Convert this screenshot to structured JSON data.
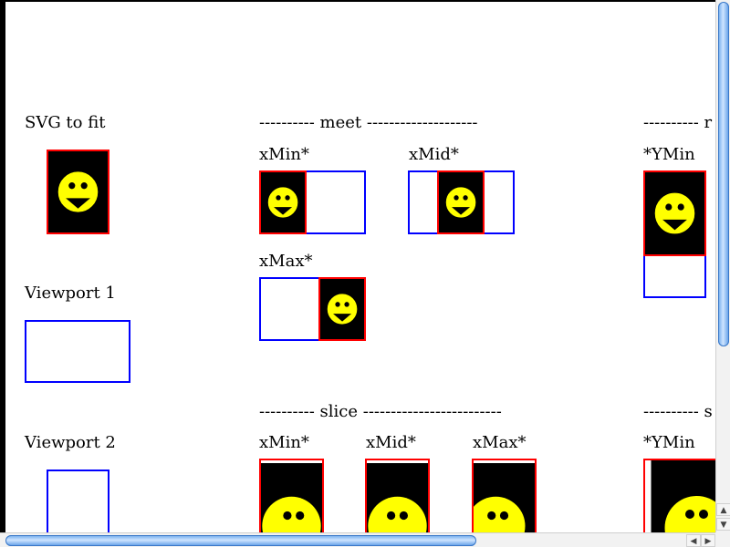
{
  "labels": {
    "svg_to_fit": "SVG to fit",
    "viewport_1": "Viewport 1",
    "viewport_2": "Viewport 2",
    "meet_header": "---------- meet --------------------",
    "meet_header_right": "---------- r",
    "slice_header": "---------- slice -------------------------",
    "slice_header_right": "---------- s",
    "xmin": "xMin*",
    "xmid": "xMid*",
    "xmax": "xMax*",
    "ymin": "*YMin"
  },
  "colors": {
    "viewport_border": "#0000ff",
    "svg_border": "#ff0000",
    "svg_background": "#000000",
    "smiley_face": "#ffff00",
    "scroll_thumb": "#6aa7ec"
  },
  "icons": {
    "smiley": "smiley-face-icon"
  },
  "scrollbars": {
    "vertical_arrow_up": "▲",
    "vertical_arrow_down": "▼",
    "horizontal_arrow_left": "◀",
    "horizontal_arrow_right": "▶"
  }
}
